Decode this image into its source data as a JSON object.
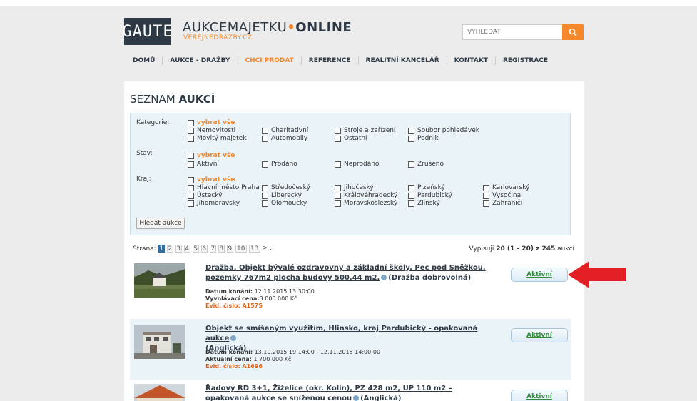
{
  "header": {
    "logo": "GAUTE",
    "brand_part1": "AUKCEMAJETKU",
    "brand_dot": "•",
    "brand_part2": "ONLINE",
    "brand_sub": "VEREJNEDRAZBY.CZ",
    "search_placeholder": "VYHLEDAT"
  },
  "nav": [
    "DOMŮ",
    "AUKCE - DRAŽBY",
    "CHCI PRODAT",
    "REFERENCE",
    "REALITNÍ KANCELÁŘ",
    "KONTAKT",
    "REGISTRACE"
  ],
  "title_prefix": "SEZNAM",
  "title_bold": "AUKCÍ",
  "filter": {
    "select_all": "vybrat vše",
    "kategorie_label": "Kategorie:",
    "kategorie": [
      "Nemovitosti",
      "Charitativní",
      "Stroje a zařízení",
      "Soubor pohledávek",
      "Movitý majetek",
      "Automobily",
      "Ostatní",
      "Podnik"
    ],
    "stav_label": "Stav:",
    "stav": [
      "Aktivní",
      "Prodáno",
      "Neprodáno",
      "Zrušeno"
    ],
    "kraj_label": "Kraj:",
    "kraj": [
      "Hlavní město Praha",
      "Středočeský",
      "Jihočeský",
      "Plzeňský",
      "Karlovarský",
      "Ústecký",
      "Liberecký",
      "Královéhradecký",
      "Pardubický",
      "Vysočina",
      "Jihomoravský",
      "Olomoucký",
      "Moravskoslezský",
      "Zlínský",
      "Zahraničí"
    ],
    "search_button": "Hledat aukce"
  },
  "pager": {
    "label": "Strana:",
    "pages": [
      "1",
      "2",
      "3",
      "4",
      "5",
      "6",
      "7",
      "8",
      "9",
      "10",
      "13",
      ">",
      ".."
    ],
    "summary_prefix": "Vypisuji",
    "summary_range": "20 (1 - 20) z 245",
    "summary_suffix": "aukcí"
  },
  "auctions": [
    {
      "title": "Dražba, Objekt bývalé ozdravovny a základní školy, Pec pod Sněžkou, pozemky 767m2 plocha budovy 500,44 m2.",
      "type": "(Dražba dobrovolná)",
      "date_label": "Datum konání:",
      "date": "12.11.2015 13:30:00",
      "price_label": "Vyvolávací cena:",
      "price": "3 000 000 Kč",
      "evid": "Evid. číslo: A1575",
      "status": "Aktivní"
    },
    {
      "title": "Objekt se smíšeným využitím, Hlinsko, kraj Pardubický - opakovaná aukce",
      "type": "(Anglická)",
      "date_label": "Datum konání:",
      "date": "13.10.2015 19:14:00 - 12.11.2015 14:00:00",
      "price_label": "Aktuální cena:",
      "price": "1 700 000 Kč",
      "evid": "Evid. číslo: A1696",
      "status": "Aktivní"
    },
    {
      "title": "Řadový RD 3+1, Žiželice (okr. Kolín), PZ 428 m2, UP 110 m2 – opakovaná aukce se sníženou cenou",
      "type": "(Anglická)",
      "status": "Aktivní"
    }
  ],
  "colors": {
    "accent": "#f4882b",
    "dark": "#2d3a46",
    "arrow": "#e31e24",
    "status": "#2f8b3a"
  }
}
